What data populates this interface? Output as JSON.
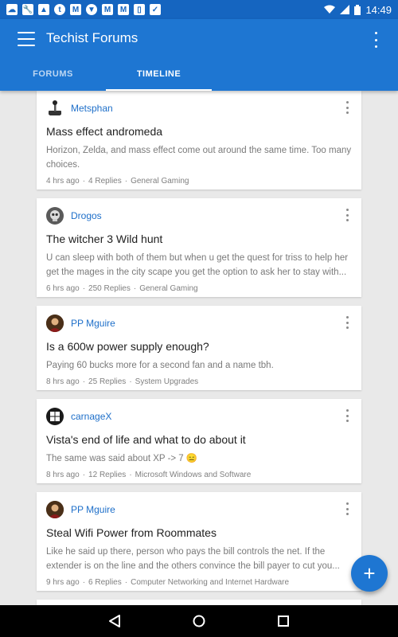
{
  "status_bar": {
    "time": "14:49",
    "notification_icons": [
      "cloud-icon",
      "wrench-icon",
      "image-icon",
      "tumblr-icon",
      "gmail-icon",
      "shield-icon",
      "gmail-icon",
      "gmail-icon",
      "phone-icon",
      "clipboard-icon"
    ]
  },
  "app_bar": {
    "title": "Techist Forums",
    "color": "#1e76d2"
  },
  "tabs": [
    {
      "label": "FORUMS",
      "selected": false
    },
    {
      "label": "TIMELINE",
      "selected": true
    }
  ],
  "threads": [
    {
      "username": "Metsphan",
      "avatar": "joystick-avatar",
      "title": "Mass effect andromeda",
      "excerpt": "Horizon, Zelda, and mass effect come out around the same time. Too many choices.",
      "time": "4 hrs ago",
      "replies": "4 Replies",
      "forum": "General Gaming"
    },
    {
      "username": "Drogos",
      "avatar": "skull-avatar",
      "title": "The witcher 3 Wild hunt",
      "excerpt": "U can sleep with both of them but when u get the quest for triss to help her get the mages in the city scape you get the option to ask her to stay with...",
      "time": "6 hrs ago",
      "replies": "250 Replies",
      "forum": "General Gaming"
    },
    {
      "username": "PP Mguire",
      "avatar": "portrait-avatar",
      "title": "Is a 600w power supply enough?",
      "excerpt": "Paying 60 bucks more for a second fan and a name tbh.",
      "time": "8 hrs ago",
      "replies": "25 Replies",
      "forum": "System Upgrades"
    },
    {
      "username": "carnageX",
      "avatar": "windows-logo-avatar",
      "title": "Vista's end of life and what to do about it",
      "excerpt": "The same was said about XP -> 7 😑",
      "time": "8 hrs ago",
      "replies": "12 Replies",
      "forum": "Microsoft Windows and Software"
    },
    {
      "username": "PP Mguire",
      "avatar": "portrait-avatar",
      "title": "Steal Wifi Power from Roommates",
      "excerpt": "Like he said up there, person who pays the bill controls the net. If the extender is on the line and the others convince the bill payer to cut you...",
      "time": "9 hrs ago",
      "replies": "6 Replies",
      "forum": "Computer Networking and Internet Hardware"
    }
  ],
  "fab": {
    "icon": "plus-icon"
  },
  "nav_bar": {
    "buttons": [
      "back-icon",
      "home-icon",
      "recents-icon"
    ]
  }
}
